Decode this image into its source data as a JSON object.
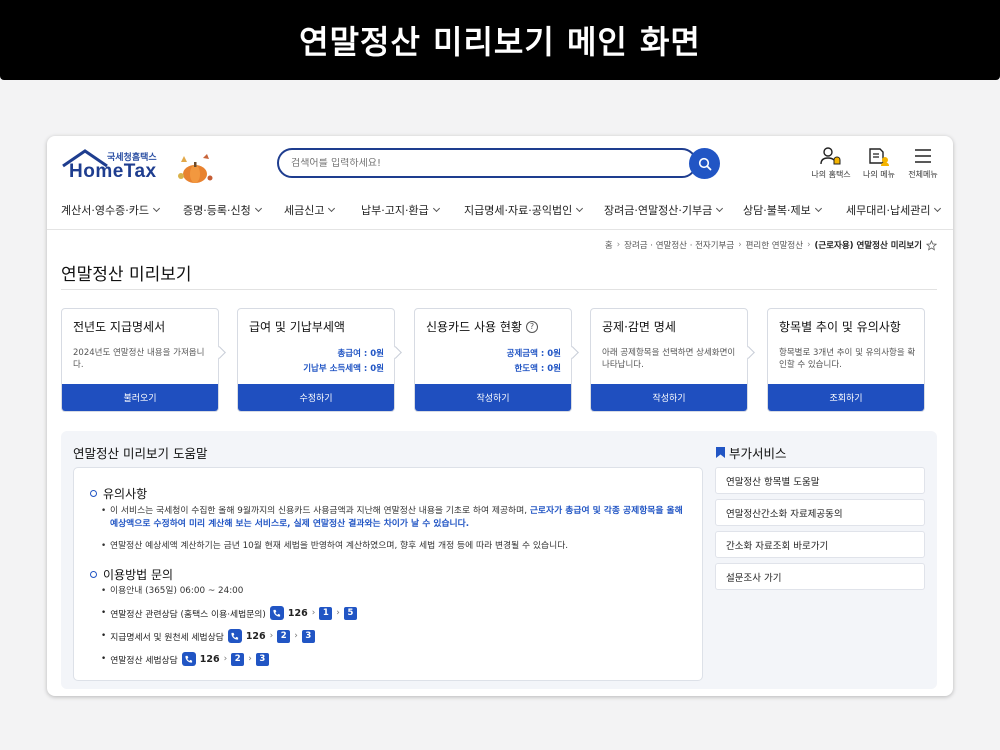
{
  "banner": {
    "title": "연말정산 미리보기 메인 화면"
  },
  "header": {
    "logo_sub": "국세청홈택스",
    "logo_main": "HomeTax",
    "search_placeholder": "검색어를 입력하세요!",
    "utils": [
      {
        "label": "나의 홈택스",
        "icon": "user-bell-icon"
      },
      {
        "label": "나의 메뉴",
        "icon": "my-menu-icon"
      },
      {
        "label": "전체메뉴",
        "icon": "hamburger-icon"
      }
    ]
  },
  "nav": [
    "계산서·영수증·카드",
    "증명·등록·신청",
    "세금신고",
    "납부·고지·환급",
    "지급명세·자료·공익법인",
    "장려금·연말정산·기부금",
    "상담·불복·제보",
    "세무대리·납세관리"
  ],
  "breadcrumb": {
    "home": "홈",
    "items": [
      "장려금 · 연말정산 · 전자기부금",
      "편리한 연말정산"
    ],
    "current": "(근로자용) 연말정산 미리보기"
  },
  "page_title": "연말정산 미리보기",
  "cards": [
    {
      "title": "전년도 지급명세서",
      "desc": "2024년도 연말정산 내용을 가져옵니다.",
      "button": "불러오기"
    },
    {
      "title": "급여 및 기납부세액",
      "values": [
        "총급여 : 0원",
        "기납부 소득세액 : 0원"
      ],
      "button": "수정하기"
    },
    {
      "title": "신용카드 사용 현황",
      "help": "?",
      "values": [
        "공제금액 : 0원",
        "한도액 : 0원"
      ],
      "button": "작성하기"
    },
    {
      "title": "공제·감면 명세",
      "desc": "아래 공제항목을 선택하면 상세화면이 나타납니다.",
      "button": "작성하기"
    },
    {
      "title": "항목별 추이 및 유의사항",
      "desc": "항목별로 3개년 추이 및 유의사항을 확인할 수 있습니다.",
      "button": "조회하기"
    }
  ],
  "help": {
    "title": "연말정산 미리보기 도움말",
    "notice_title": "유의사항",
    "notice_1_a": "이 서비스는 국세청이 수집한 올해 9월까지의 신용카드 사용금액과 지난해 연말정산 내용을 기초로 하여 제공하며, ",
    "notice_1_b": "근로자가 총급여 및 각종 공제항목을 올해 예상액으로 수정하여 미리 계산해 보는 서비스로, 실제 연말정산 결과와는 차이가 날 수 있습니다.",
    "notice_2": "연말정산 예상세액 계산하기는 금년 10월 현재 세법을 반영하여 계산하였으며, 향후 세법 개정 등에 따라 변경될 수 있습니다.",
    "inquiry_title": "이용방법 문의",
    "inquiry_hours": "이용안내 (365일) 06:00 ~ 24:00",
    "contacts": [
      {
        "label": "연말정산 관련상담 (홈택스 이용·세법문의)",
        "number": "126",
        "steps": [
          "1",
          "5"
        ]
      },
      {
        "label": "지급명세서 및 원천세 세법상담",
        "number": "126",
        "steps": [
          "2",
          "3"
        ]
      },
      {
        "label": "연말정산 세법상담",
        "number": "126",
        "steps": [
          "2",
          "3"
        ]
      }
    ]
  },
  "side": {
    "title": "부가서비스",
    "links": [
      "연말정산 항목별 도움말",
      "연말정산간소화 자료제공동의",
      "간소화 자료조회 바로가기",
      "설문조사 가기"
    ]
  },
  "colors": {
    "primary": "#1f4fbf",
    "accent_blue": "#2155c4",
    "navy": "#1e3d8f"
  }
}
